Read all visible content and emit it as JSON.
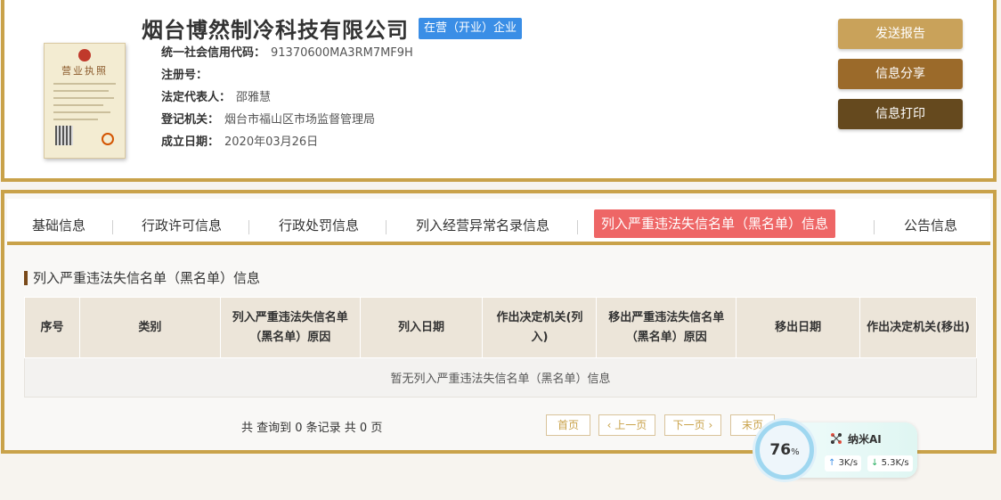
{
  "company": {
    "name": "烟台博然制冷科技有限公司",
    "status": "在营（开业）企业",
    "license_title": "营业执照",
    "fields": [
      {
        "key": "统一社会信用代码：",
        "value": "91370600MA3RM7MF9H"
      },
      {
        "key": "注册号：",
        "value": ""
      },
      {
        "key": "法定代表人：",
        "value": "邵雅慧"
      },
      {
        "key": "登记机关：",
        "value": "烟台市福山区市场监督管理局"
      },
      {
        "key": "成立日期：",
        "value": "2020年03月26日"
      }
    ]
  },
  "actions": {
    "report": "发送报告",
    "share": "信息分享",
    "print": "信息打印"
  },
  "tabs": [
    "基础信息",
    "行政许可信息",
    "行政处罚信息",
    "列入经营异常名录信息",
    "列入严重违法失信名单（黑名单）信息",
    "公告信息"
  ],
  "section": {
    "title": "列入严重违法失信名单（黑名单）信息",
    "columns": [
      "序号",
      "类别",
      "列入严重违法失信名单（黑名单）原因",
      "列入日期",
      "作出决定机关(列入)",
      "移出严重违法失信名单（黑名单）原因",
      "移出日期",
      "作出决定机关(移出)"
    ],
    "empty_text": "暂无列入严重违法失信名单（黑名单）信息"
  },
  "pager": {
    "summary": "共 查询到 0 条记录 共 0 页",
    "first": "首页",
    "prev": "上一页",
    "next": "下一页",
    "last": "末页"
  },
  "widget": {
    "percent": "76",
    "percent_unit": "%",
    "name": "纳米AI",
    "upload": "3K/s",
    "download": "5.3K/s"
  },
  "colors": {
    "gold_border": "#c9a24a",
    "active_tab": "#ee6666",
    "status_badge": "#3a8ee6"
  }
}
